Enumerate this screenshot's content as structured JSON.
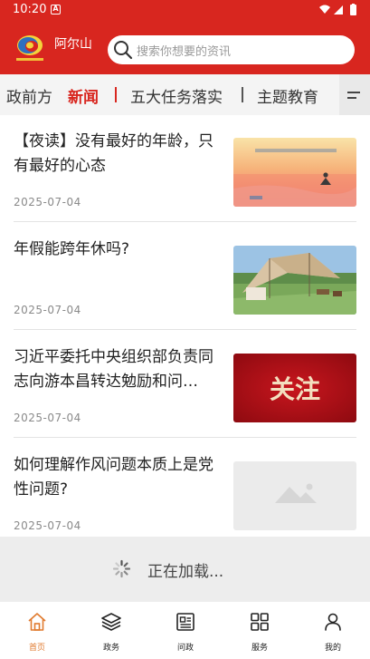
{
  "status_bar": {
    "time": "10:20",
    "notification": "A"
  },
  "header": {
    "site_name": "阿尔山",
    "search_placeholder": "搜索你想要的资讯",
    "logo_text": "资讯阿尔山"
  },
  "tabs": [
    "政前方",
    "新闻",
    "五大任务落实",
    "主题教育"
  ],
  "active_tab": "新闻",
  "news": [
    {
      "title": "【夜读】没有最好的年龄，只有最好的心态",
      "date": "2025-07-04",
      "thumb": "sunset-beach-image"
    },
    {
      "title": "年假能跨年休吗?",
      "date": "2025-07-04",
      "thumb": "camping-tent-image"
    },
    {
      "title": "习近平委托中央组织部负责同志向游本昌转达勉励和问…",
      "date": "2025-07-04",
      "thumb": "guanzhu-banner-image",
      "thumb_text": "关注"
    },
    {
      "title": "如何理解作风问题本质上是党性问题?",
      "date": "2025-07-04",
      "thumb": "placeholder-image"
    }
  ],
  "loading_text": "正在加载...",
  "bottom_nav": [
    {
      "label": "首页",
      "icon": "home-icon",
      "active": true
    },
    {
      "label": "政务",
      "icon": "layers-icon",
      "active": false
    },
    {
      "label": "问政",
      "icon": "newspaper-icon",
      "active": false
    },
    {
      "label": "服务",
      "icon": "grid-icon",
      "active": false
    },
    {
      "label": "我的",
      "icon": "user-icon",
      "active": false
    }
  ],
  "colors": {
    "brand_red": "#d8261f",
    "nav_active": "#e07a2e"
  }
}
